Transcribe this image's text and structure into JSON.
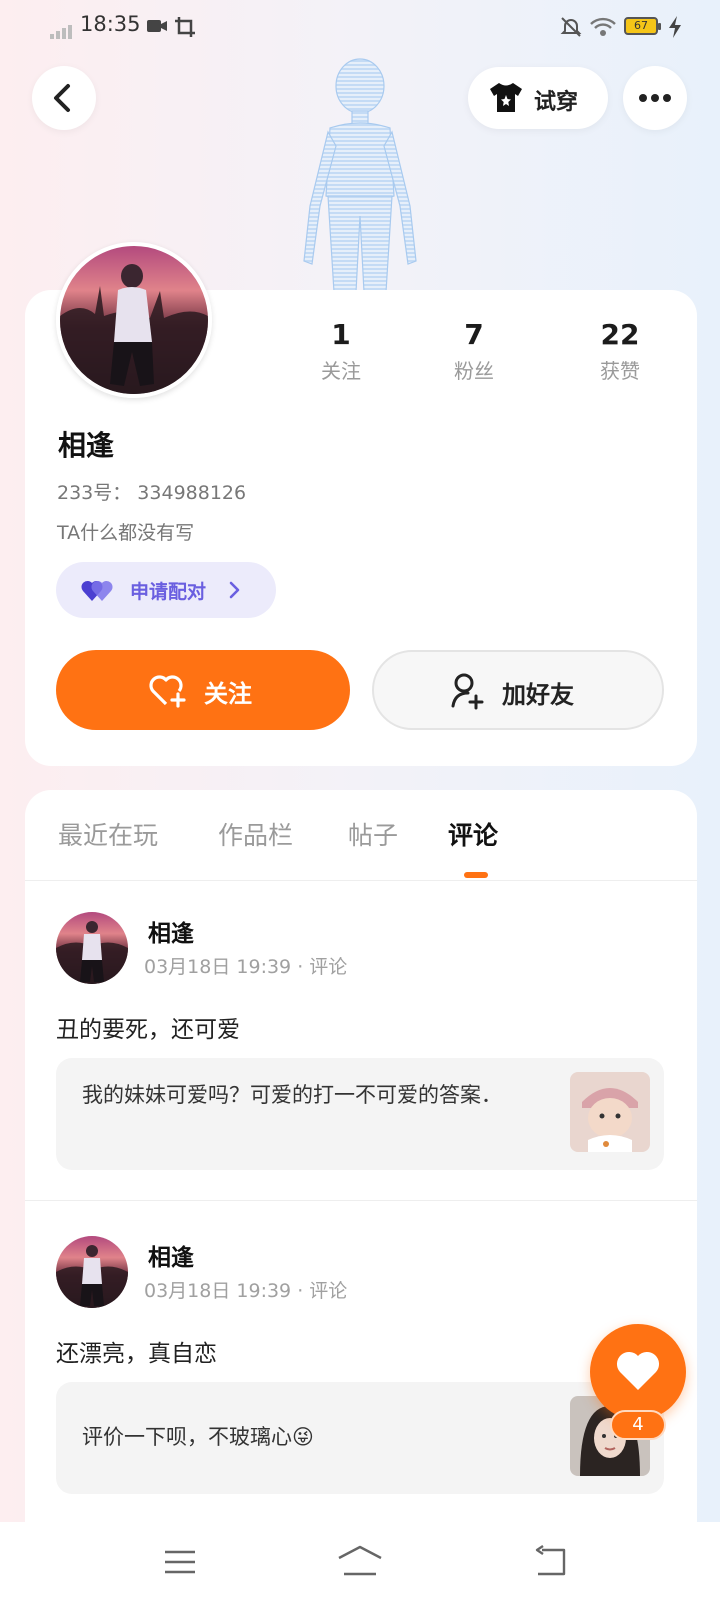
{
  "status_bar": {
    "time": "18:35",
    "battery": "67"
  },
  "header": {
    "try_on_label": "试穿"
  },
  "profile": {
    "stats": [
      {
        "value": "1",
        "label": "关注"
      },
      {
        "value": "7",
        "label": "粉丝"
      },
      {
        "value": "22",
        "label": "获赞"
      }
    ],
    "nickname": "相逢",
    "id_line": "233号： 334988126",
    "bio": "TA什么都没有写",
    "match_label": "申请配对",
    "follow_label": "关注",
    "add_friend_label": "加好友"
  },
  "tabs": [
    {
      "label": "最近在玩",
      "active": false
    },
    {
      "label": "作品栏",
      "active": false
    },
    {
      "label": "帖子",
      "active": false
    },
    {
      "label": "评论",
      "active": true
    }
  ],
  "comments": [
    {
      "author": "相逢",
      "meta": "03月18日 19:39 · 评论",
      "text": "丑的要死，还可爱",
      "quote": "我的妹妹可爱吗？可爱的打一不可爱的答案．"
    },
    {
      "author": "相逢",
      "meta": "03月18日 19:39 · 评论",
      "text": "还漂亮，真自恋",
      "quote": "评价一下呗，不玻璃心😜"
    }
  ],
  "fab": {
    "badge": "4"
  },
  "colors": {
    "accent": "#ff7213",
    "match": "#6a5fe0"
  }
}
